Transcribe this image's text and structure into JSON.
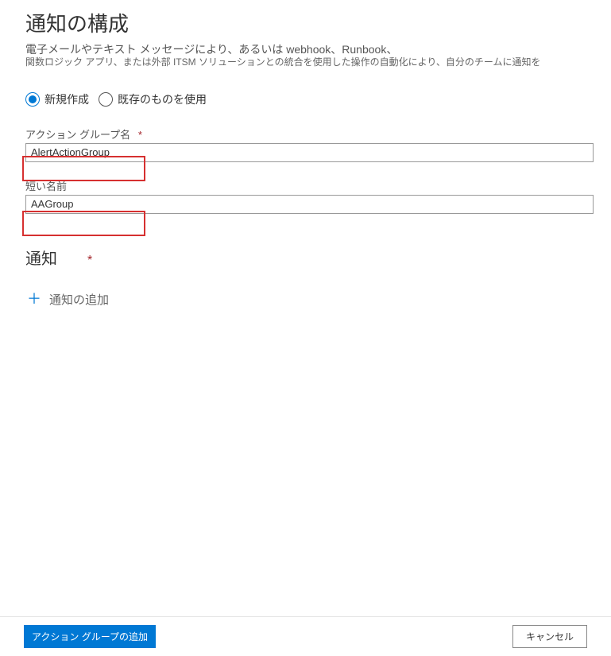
{
  "header": {
    "title": "通知の構成",
    "description_line1": "電子メールやテキスト メッセージにより、あるいは webhook、Runbook、",
    "description_line2": "関数ロジック アプリ、または外部 ITSM ソリューションとの統合を使用した操作の自動化により、自分のチームに通知を"
  },
  "mode": {
    "create_new": "新規作成",
    "use_existing": "既存のものを使用"
  },
  "form": {
    "action_group_name_label": "アクション グループ名",
    "action_group_name_value": "AlertActionGroup",
    "short_name_label": "短い名前",
    "short_name_value": "AAGroup",
    "required_mark": "*"
  },
  "notifications": {
    "section_title": "通知",
    "add_label": "通知の追加"
  },
  "footer": {
    "primary": "アクション グループの追加",
    "secondary": "キャンセル"
  }
}
